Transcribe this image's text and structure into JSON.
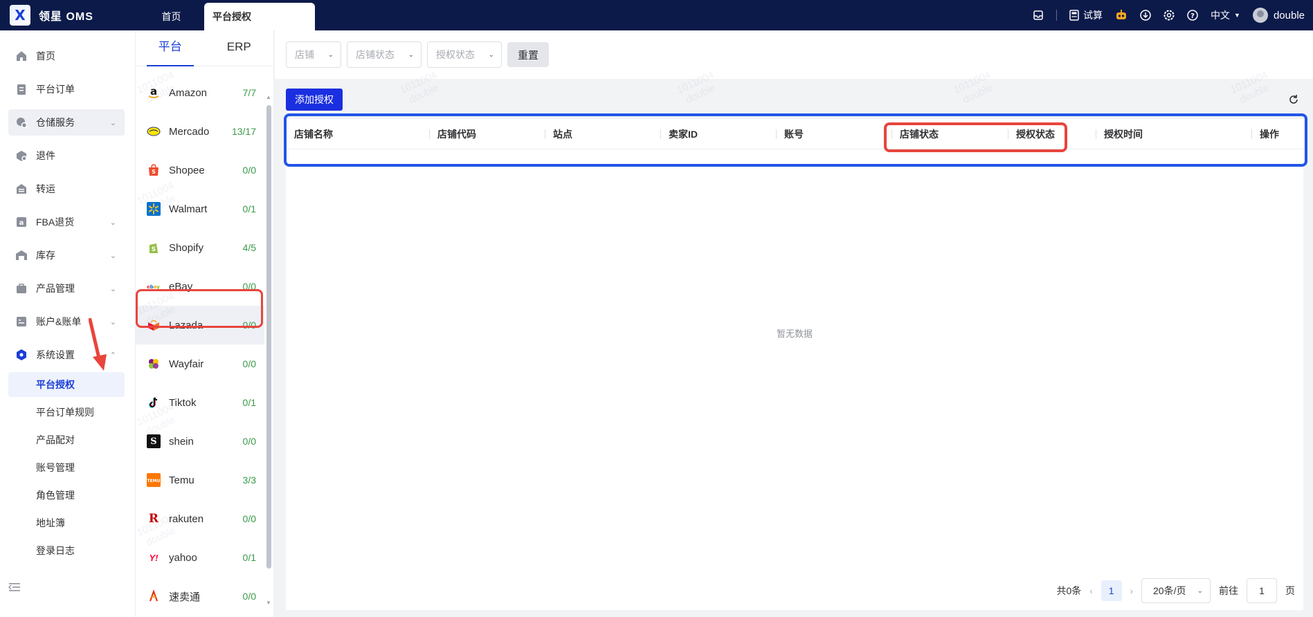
{
  "app": {
    "brand": "领星 OMS",
    "logo_glyph": "X"
  },
  "top_tabs": [
    {
      "label": "首页"
    },
    {
      "label": "平台授权"
    }
  ],
  "top_right": {
    "trial_label": "试算",
    "language": "中文",
    "username": "double"
  },
  "sidebar": {
    "items": [
      {
        "label": "首页",
        "icon": "home-icon"
      },
      {
        "label": "平台订单",
        "icon": "clipboard-icon"
      },
      {
        "label": "仓储服务",
        "icon": "warehouse-icon"
      },
      {
        "label": "退件",
        "icon": "return-icon"
      },
      {
        "label": "转运",
        "icon": "transfer-icon"
      },
      {
        "label": "FBA退货",
        "icon": "fba-icon"
      },
      {
        "label": "库存",
        "icon": "inventory-icon"
      },
      {
        "label": "产品管理",
        "icon": "product-icon"
      },
      {
        "label": "账户&账单",
        "icon": "account-icon"
      },
      {
        "label": "系统设置",
        "icon": "settings-hex-icon"
      }
    ],
    "sub_items": [
      {
        "label": "平台授权"
      },
      {
        "label": "平台订单规则"
      },
      {
        "label": "产品配对"
      },
      {
        "label": "账号管理"
      },
      {
        "label": "角色管理"
      },
      {
        "label": "地址簿"
      },
      {
        "label": "登录日志"
      }
    ]
  },
  "platform_panel": {
    "tabs": [
      {
        "label": "平台"
      },
      {
        "label": "ERP"
      }
    ],
    "platforms": [
      {
        "name": "Amazon",
        "count": "7/7"
      },
      {
        "name": "Mercado",
        "count": "13/17"
      },
      {
        "name": "Shopee",
        "count": "0/0"
      },
      {
        "name": "Walmart",
        "count": "0/1"
      },
      {
        "name": "Shopify",
        "count": "4/5"
      },
      {
        "name": "eBay",
        "count": "0/0"
      },
      {
        "name": "Lazada",
        "count": "0/0"
      },
      {
        "name": "Wayfair",
        "count": "0/0"
      },
      {
        "name": "Tiktok",
        "count": "0/1"
      },
      {
        "name": "shein",
        "count": "0/0"
      },
      {
        "name": "Temu",
        "count": "3/3"
      },
      {
        "name": "rakuten",
        "count": "0/0"
      },
      {
        "name": "yahoo",
        "count": "0/1"
      },
      {
        "name": "速卖通",
        "count": "0/0"
      }
    ]
  },
  "filters": {
    "store_placeholder": "店铺",
    "store_status_placeholder": "店铺状态",
    "auth_status_placeholder": "授权状态",
    "reset_label": "重置"
  },
  "table": {
    "add_label": "添加授权",
    "columns": [
      "店铺名称",
      "店铺代码",
      "站点",
      "卖家ID",
      "账号",
      "店铺状态",
      "授权状态",
      "授权时间",
      "操作"
    ],
    "empty_text": "暂无数据"
  },
  "pagination": {
    "total_label": "共0条",
    "current_page": "1",
    "page_size": "20条/页",
    "goto_prefix": "前往",
    "goto_value": "1",
    "goto_suffix": "页"
  },
  "watermark": {
    "line1": "1011004",
    "line2": "double"
  },
  "colors": {
    "topbar": "#0c1a4a",
    "primary": "#1a2fe0",
    "count_green": "#3a9a48",
    "annot_red": "#e8453c",
    "annot_blue": "#2255e8"
  }
}
